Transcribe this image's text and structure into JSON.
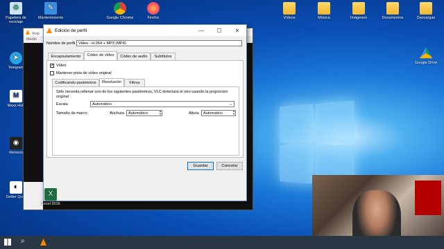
{
  "desktop": {
    "icons_left": [
      {
        "name": "recycle-bin-icon",
        "label": "Papelera de reciclaje"
      },
      {
        "name": "telegram-icon",
        "label": "Telegram"
      },
      {
        "name": "app-icon",
        "label": "Maxx Hub"
      },
      {
        "name": "app2-icon",
        "label": "Reinicio"
      },
      {
        "name": "app3-icon",
        "label": "Getter Quot"
      }
    ],
    "icons_top": [
      {
        "label": "Mantenimiento"
      },
      {
        "label": "Google Chrome"
      },
      {
        "label": "Firefox"
      }
    ],
    "icons_right": [
      {
        "label": "Vídeos"
      },
      {
        "label": "Música"
      },
      {
        "label": "Imágenes"
      },
      {
        "label": "Documentos"
      },
      {
        "label": "Descargas"
      },
      {
        "label": "Google Drive"
      }
    ],
    "bottom_left_label": "Excel 2016"
  },
  "vlc_back": {
    "title": "Rep",
    "menu": "Medio"
  },
  "dialog": {
    "title": "Edición de perfil",
    "profile_label": "Nombre de perfil",
    "profile_value": "Video - H.264 + MP3 (MP4)",
    "tabs": [
      "Encapsulamiento",
      "Códec de vídeo",
      "Códec de audio",
      "Subtítulos"
    ],
    "video_checkbox": "Vídeo",
    "keep_track_checkbox": "Mantener pista de vídeo original",
    "subtabs": [
      "Codificando parámetros",
      "Resolución",
      "Filtros"
    ],
    "info_text": "Sólo necesita rellenar uno de los siguientes parámetros, VLC detectará el otro usando la proporción original",
    "scale_label": "Escala",
    "scale_value": "Automático",
    "frame_size_label": "Tamaño de marco",
    "width_label": "Anchura",
    "width_value": "Automático",
    "height_label": "Altura",
    "height_value": "Automático",
    "save_button": "Guardar",
    "cancel_button": "Cancelar"
  },
  "colors": {
    "dialog_bg": "#f0f0f0",
    "accent": "#0078d7"
  }
}
